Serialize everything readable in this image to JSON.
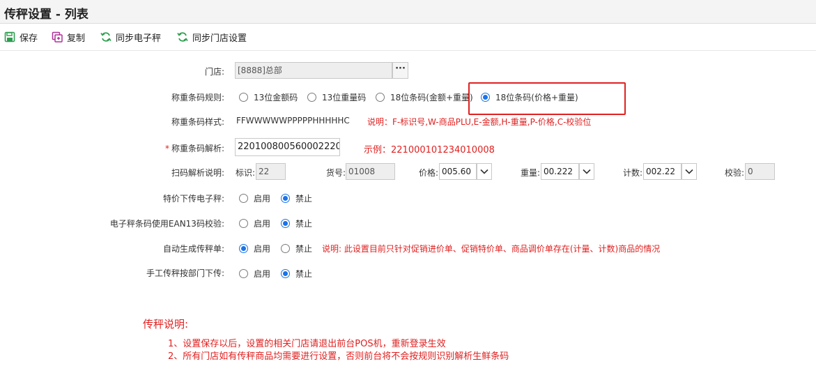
{
  "page": {
    "title": "传秤设置 - 列表"
  },
  "toolbar": {
    "save": "保存",
    "copy": "复制",
    "sync_scale": "同步电子秤",
    "sync_store": "同步门店设置"
  },
  "form": {
    "store": {
      "label": "门店:",
      "value": "[8888]总部",
      "button": "···"
    },
    "barcode_rule": {
      "label": "称重条码规则:",
      "options": [
        "13位金额码",
        "13位重量码",
        "18位条码(金额+重量)",
        "18位条码(价格+重量)"
      ],
      "selected_index": 3
    },
    "barcode_style": {
      "label": "称重条码样式:",
      "value": "FFWWWWWPPPPPHHHHHC",
      "note": "说明：F-标识号,W-商品PLU,E-金额,H-重量,P-价格,C-校验位"
    },
    "barcode_parse": {
      "label": "称重条码解析:",
      "required_mark": "*",
      "value": "220100800560002220",
      "example": "示例：221000101234010008"
    },
    "scan_parse": {
      "label": "扫码解析说明:",
      "id_label": "标识:",
      "id_value": "22",
      "code_label": "货号:",
      "code_value": "01008",
      "price_label": "价格:",
      "price_value": "005.60",
      "weight_label": "重量:",
      "weight_value": "00.222",
      "count_label": "计数:",
      "count_value": "002.22",
      "check_label": "校验:",
      "check_value": "0"
    },
    "special_price": {
      "label": "特价下传电子秤:",
      "on": "启用",
      "off": "禁止",
      "enabled": false
    },
    "ean13": {
      "label": "电子秤条码使用EAN13码校验:",
      "on": "启用",
      "off": "禁止",
      "enabled": false
    },
    "auto_generate": {
      "label": "自动生成传秤单:",
      "on": "启用",
      "off": "禁止",
      "enabled": true,
      "note": "说明: 此设置目前只针对促销进价单、促销特价单、商品调价单存在(计量、计数)商品的情况"
    },
    "manual_dept": {
      "label": "手工传秤按部门下传:",
      "on": "启用",
      "off": "禁止",
      "enabled": false
    }
  },
  "notes": {
    "title": "传秤说明:",
    "lines": [
      "1、设置保存以后，设置的相关门店请退出前台POS机，重新登录生效",
      "2、所有门店如有传秤商品均需要进行设置，否则前台将不会按规则识别解析生鲜条码"
    ]
  },
  "colors": {
    "accent_red": "#e02020",
    "radio_blue": "#1a73e8",
    "icon_green": "#2e9e4f",
    "icon_purple": "#b0309a"
  }
}
